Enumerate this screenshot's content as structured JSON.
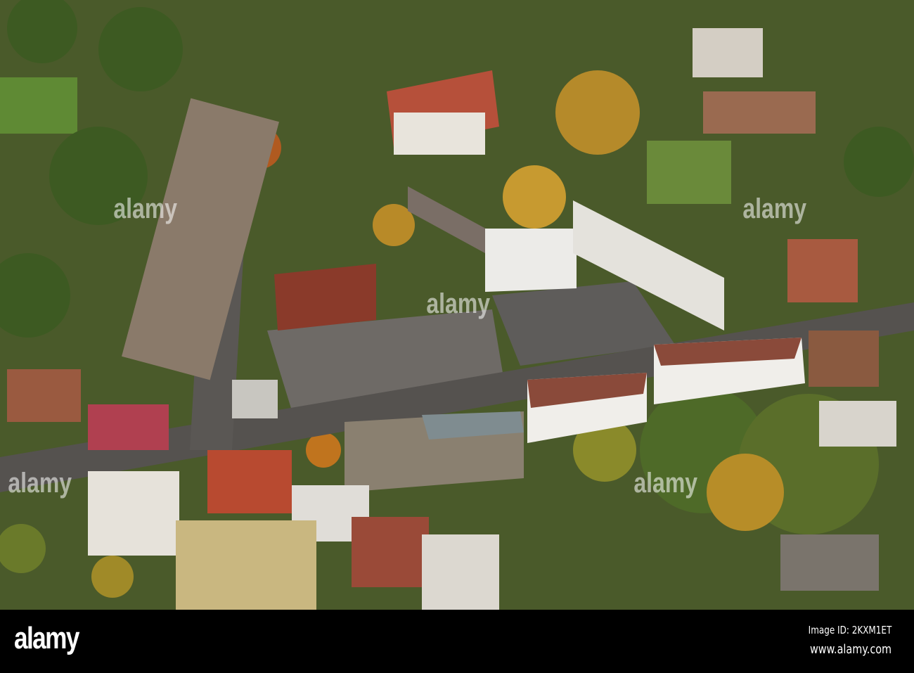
{
  "watermark": "alamy",
  "footer": {
    "logo": "alamy",
    "image_id": "Image ID: 2KXM1ET",
    "url": "www.alamy.com"
  }
}
